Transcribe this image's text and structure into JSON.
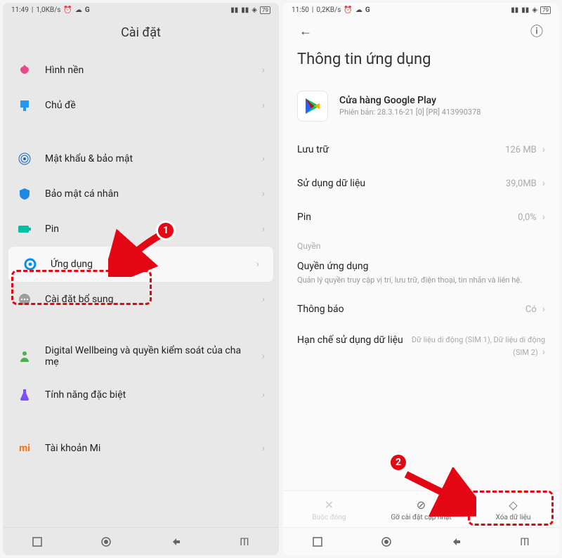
{
  "left": {
    "status": {
      "time": "11:49",
      "speed": "1,0KB/s",
      "battery": "79"
    },
    "title": "Cài đặt",
    "items": [
      {
        "id": "wallpaper",
        "label": "Hình nền",
        "iconColor": "#e94b8a"
      },
      {
        "id": "theme",
        "label": "Chủ đề",
        "iconColor": "#2196f3"
      },
      {
        "id": "security",
        "label": "Mật khẩu & bảo mật",
        "iconColor": "#1565c0"
      },
      {
        "id": "privacy",
        "label": "Bảo mật cá nhân",
        "iconColor": "#1e88e5"
      },
      {
        "id": "battery",
        "label": "Pin",
        "iconColor": "#00bfa5"
      },
      {
        "id": "apps",
        "label": "Ứng dụng",
        "iconColor": "#0091ea",
        "highlighted": true
      },
      {
        "id": "more",
        "label": "Cài đặt bổ sung",
        "iconColor": "#9e9e9e"
      },
      {
        "id": "wellbeing",
        "label": "Digital Wellbeing và quyền kiểm soát của cha mẹ",
        "iconColor": "#4caf50"
      },
      {
        "id": "special",
        "label": "Tính năng đặc biệt",
        "iconColor": "#7c4dff"
      },
      {
        "id": "mi",
        "label": "Tài khoản Mi",
        "iconColor": "#ff6f00"
      }
    ],
    "badge": "1"
  },
  "right": {
    "status": {
      "time": "11:50",
      "speed": "0,2KB/s",
      "battery": "79"
    },
    "title": "Thông tin ứng dụng",
    "app": {
      "name": "Cửa hàng Google Play",
      "version": "Phiên bản: 28.3.16-21 [0] [PR] 413990378"
    },
    "rows": [
      {
        "label": "Lưu trữ",
        "value": "126 MB"
      },
      {
        "label": "Sử dụng dữ liệu",
        "value": "39,0MB"
      },
      {
        "label": "Pin",
        "value": "0,0%"
      }
    ],
    "permSection": "Quyền",
    "perm": {
      "title": "Quyền ứng dụng",
      "desc": "Quản lý quyền truy cập vị trí, lưu trữ, điện thoại, tin nhắn và liên hệ."
    },
    "notif": {
      "label": "Thông báo",
      "value": "Có"
    },
    "restrict": {
      "label": "Hạn chế sử dụng dữ liệu",
      "value": "Dữ liệu di động (SIM 1), Dữ liệu di động (SIM 2)"
    },
    "actions": {
      "force": "Buộc đóng",
      "uninstall": "Gỡ cài đặt cập nhật",
      "clear": "Xóa dữ liệu"
    },
    "badge": "2"
  }
}
